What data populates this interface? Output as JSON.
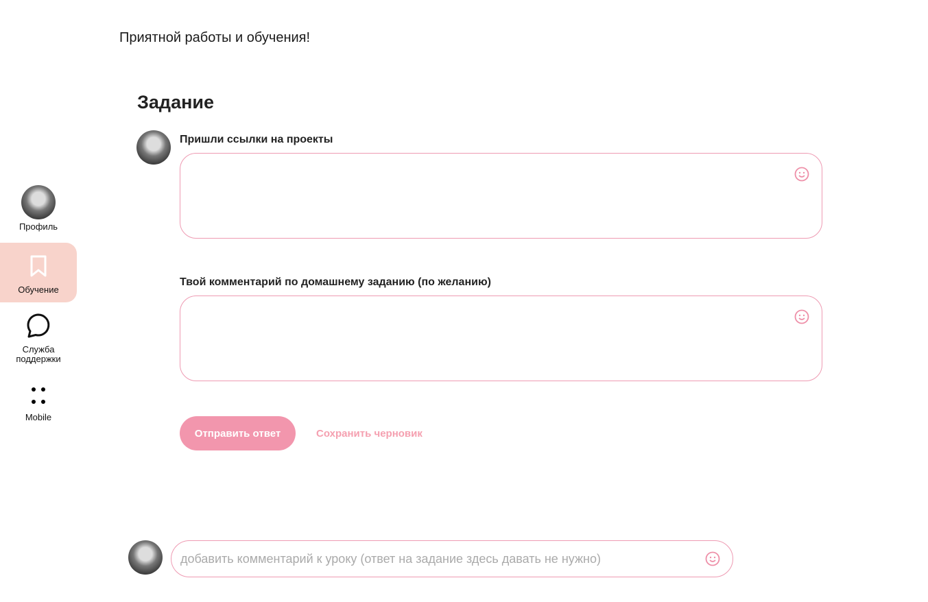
{
  "sidebar": {
    "items": [
      {
        "label": "Профиль"
      },
      {
        "label": "Обучение"
      },
      {
        "label": "Служба поддержки"
      },
      {
        "label": "Mobile"
      }
    ]
  },
  "lesson": {
    "intro": "Приятной работы и обучения!"
  },
  "task": {
    "title": "Задание",
    "field1_label": "Пришли ссылки на проекты",
    "field2_label": "Твой комментарий по домашнему заданию (по желанию)",
    "submit": "Отправить ответ",
    "draft": "Сохранить черновик"
  },
  "comment": {
    "placeholder": "добавить комментарий к уроку (ответ на задание здесь давать не нужно)"
  },
  "colors": {
    "accent": "#f296ad",
    "active_bg": "#f8d3cb"
  }
}
